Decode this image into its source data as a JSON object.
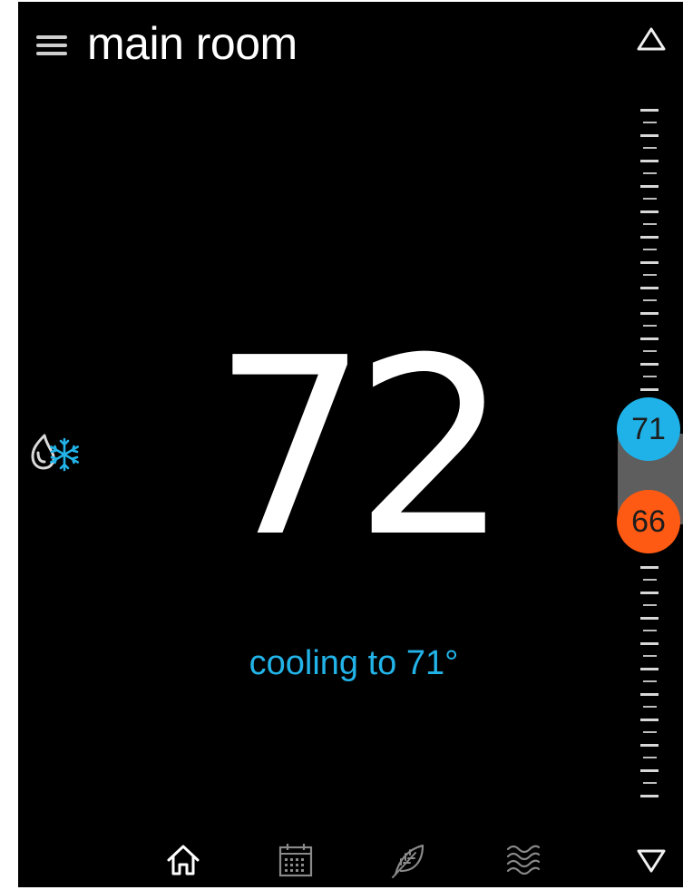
{
  "header": {
    "room_name": "main room"
  },
  "display": {
    "current_temperature": "72",
    "status": "cooling to 71°"
  },
  "setpoints": {
    "cool_setpoint": "71",
    "heat_setpoint": "66",
    "cool_color": "#1fb2e8",
    "heat_color": "#ff5a13"
  },
  "mode": {
    "icon": "heat-cool-auto-icon",
    "heat_color": "#d9d9d9",
    "cool_color": "#22b3e8"
  },
  "scale": {
    "up_icon": "triangle-up-icon",
    "down_icon": "triangle-down-icon"
  },
  "bottom_nav": [
    {
      "name": "home",
      "icon": "home-icon",
      "active": true
    },
    {
      "name": "schedule",
      "icon": "calendar-icon",
      "active": false
    },
    {
      "name": "eco",
      "icon": "leaf-icon",
      "active": false
    },
    {
      "name": "humidity",
      "icon": "waves-icon",
      "active": false
    }
  ],
  "colors": {
    "background": "#000000",
    "text": "#ffffff",
    "accent": "#22b3e8",
    "muted": "#8a8a8a"
  }
}
